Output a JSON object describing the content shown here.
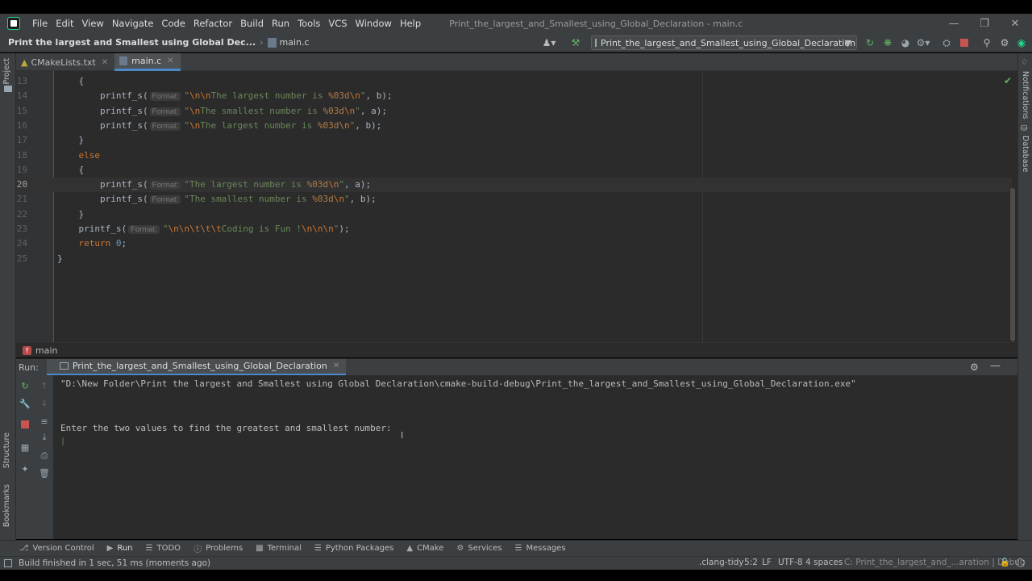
{
  "menu": {
    "items": [
      "File",
      "Edit",
      "View",
      "Navigate",
      "Code",
      "Refactor",
      "Build",
      "Run",
      "Tools",
      "VCS",
      "Window",
      "Help"
    ],
    "window_title": "Print_the_largest_and_Smallest_using_Global_Declaration - main.c"
  },
  "nav": {
    "project": "Print the largest and Smallest using Global Dec...",
    "file": "main.c",
    "run_config": "Print_the_largest_and_Smallest_using_Global_Declaration | Debug"
  },
  "side_labels": {
    "project": "Project",
    "structure": "Structure",
    "bookmarks": "Bookmarks",
    "notifications": "Notifications",
    "database": "Database"
  },
  "tabs": [
    {
      "label": "CMakeLists.txt",
      "icon": "cmake-icon"
    },
    {
      "label": "main.c",
      "icon": "c-file-icon",
      "active": true
    }
  ],
  "editor": {
    "hint": "Format:",
    "current_line": 20,
    "lines": [
      {
        "n": "13",
        "t": "    {"
      },
      {
        "n": "14",
        "t": "        printf_s( \"\\n\\nThe largest number is %03d\\n\", b);"
      },
      {
        "n": "15",
        "t": "        printf_s( \"\\nThe smallest number is %03d\\n\", a);"
      },
      {
        "n": "16",
        "t": "        printf_s( \"\\nThe largest number is %03d\\n\", b);"
      },
      {
        "n": "17",
        "t": "    }"
      },
      {
        "n": "18",
        "t": "    else"
      },
      {
        "n": "19",
        "t": "    {"
      },
      {
        "n": "20",
        "t": "        printf_s( \"The largest number is %03d\\n\", a);"
      },
      {
        "n": "21",
        "t": "        printf_s( \"The smallest number is %03d\\n\", b);"
      },
      {
        "n": "22",
        "t": "    }"
      },
      {
        "n": "23",
        "t": "    printf_s( \"\\n\\n\\t\\t\\tCoding is Fun !\\n\\n\\n\");"
      },
      {
        "n": "24",
        "t": "    return 0;"
      },
      {
        "n": "25",
        "t": "}"
      }
    ]
  },
  "function_breadcrumb": "main",
  "run": {
    "label": "Run:",
    "tab": "Print_the_largest_and_Smallest_using_Global_Declaration",
    "console": [
      "\"D:\\New Folder\\Print the largest and Smallest using Global Declaration\\cmake-build-debug\\Print_the_largest_and_Smallest_using_Global_Declaration.exe\"",
      "",
      "",
      "Enter the two values to find the greatest and smallest number:"
    ]
  },
  "tool_windows": [
    {
      "label": "Version Control",
      "icon": "branch-icon"
    },
    {
      "label": "Run",
      "icon": "run-icon",
      "active": true
    },
    {
      "label": "TODO",
      "icon": "list-icon"
    },
    {
      "label": "Problems",
      "icon": "info-icon"
    },
    {
      "label": "Terminal",
      "icon": "terminal-icon"
    },
    {
      "label": "Python Packages",
      "icon": "layers-icon"
    },
    {
      "label": "CMake",
      "icon": "cmake-icon"
    },
    {
      "label": "Services",
      "icon": "services-icon"
    },
    {
      "label": "Messages",
      "icon": "messages-icon"
    }
  ],
  "status": {
    "message": "Build finished in 1 sec, 51 ms (moments ago)",
    "linter": ".clang-tidy",
    "position": "5:2",
    "line_sep": "LF",
    "encoding": "UTF-8",
    "indent": "4 spaces",
    "context": "C: Print_the_largest_and_...aration | Debug"
  },
  "colors": {
    "keyword": "#cc7832",
    "string": "#6a8759",
    "number": "#6897bb",
    "accent": "#4a88c7"
  }
}
